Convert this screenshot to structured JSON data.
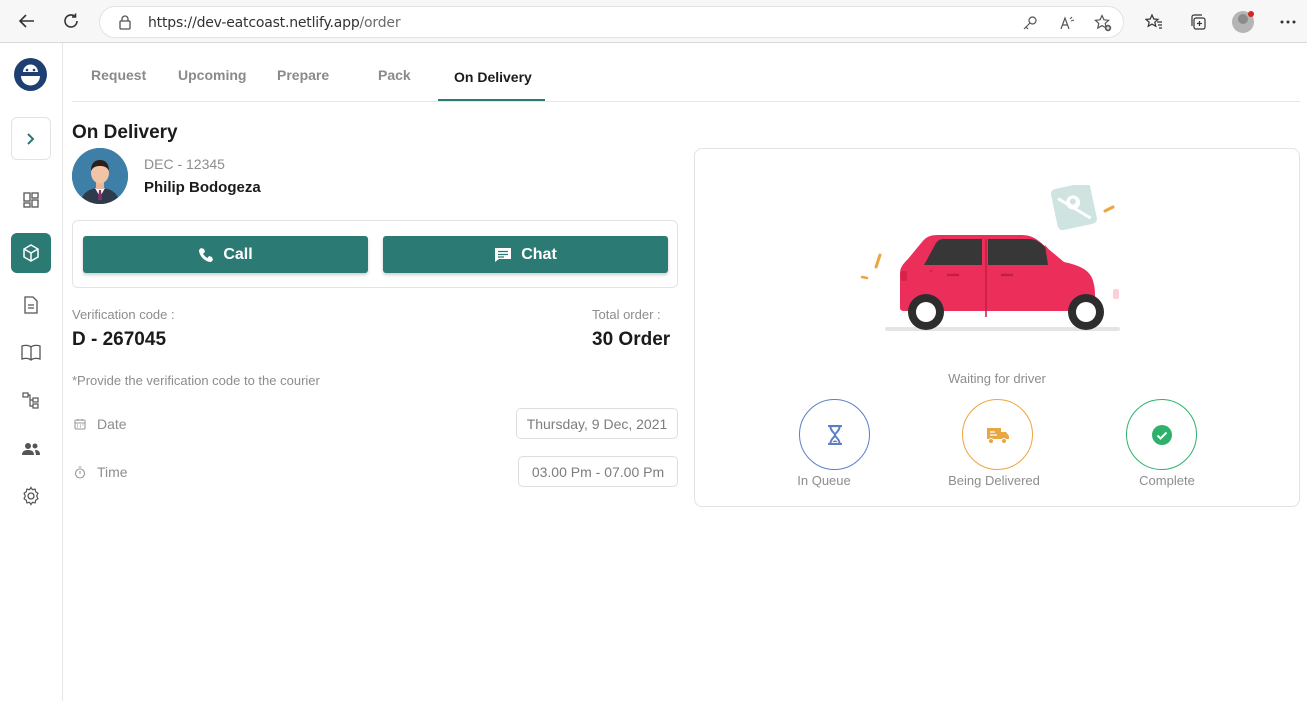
{
  "browser": {
    "url_domain": "https://dev-eatcoast.netlify.app",
    "url_path": "/order"
  },
  "tabs": [
    {
      "label": "Request"
    },
    {
      "label": "Upcoming"
    },
    {
      "label": "Prepare"
    },
    {
      "label": "Pack"
    },
    {
      "label": "On Delivery"
    }
  ],
  "order": {
    "title": "On Delivery",
    "id": "DEC - 12345",
    "customer": "Philip Bodogeza",
    "call_label": "Call",
    "chat_label": "Chat",
    "verification_label": "Verification code :",
    "verification_code": "D - 267045",
    "total_label": "Total order :",
    "total_value": "30 Order",
    "note": "*Provide the verification code to the courier",
    "date_label": "Date",
    "date_value": "Thursday, 9 Dec, 2021",
    "time_label": "Time",
    "time_value": "03.00 Pm - 07.00 Pm"
  },
  "status": {
    "text": "Waiting for driver",
    "steps": [
      {
        "label": "In Queue",
        "color": "#5b7fc7"
      },
      {
        "label": "Being Delivered",
        "color": "#eaa640"
      },
      {
        "label": "Complete",
        "color": "#2fb06b"
      }
    ]
  },
  "colors": {
    "accent": "#2b7a74",
    "car": "#ec2f5a"
  }
}
